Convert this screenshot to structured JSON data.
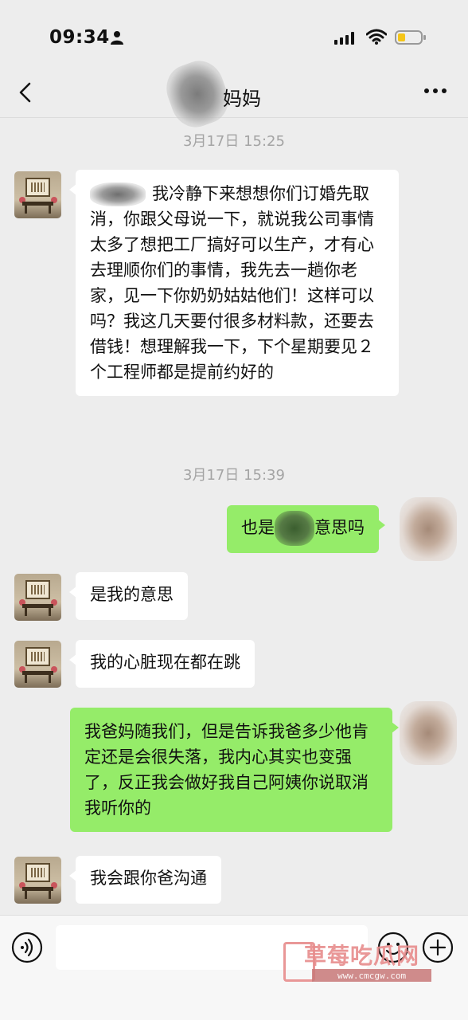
{
  "status_bar": {
    "time": "09:34",
    "icons": [
      "person-icon",
      "signal-icon",
      "wifi-icon",
      "battery-icon"
    ],
    "battery_color": "#f5c518"
  },
  "header": {
    "title": "妈妈",
    "back_icon": "chevron-left-icon",
    "more_icon": "more-dots-icon"
  },
  "messages": [
    {
      "type": "timestamp",
      "text": "3月17日 15:25"
    },
    {
      "type": "in",
      "text": "我冷静下来想想你们订婚先取消，你跟父母说一下，就说我公司事情太多了想把工厂搞好可以生产，才有心去理顺你们的事情，我先去一趟你老家，见一下你奶奶姑姑他们！这样可以吗？我这几天要付很多材料款，还要去借钱！想理解我一下，下个星期要见２个工程师都是提前约好的"
    },
    {
      "type": "timestamp",
      "text": "3月17日 15:39"
    },
    {
      "type": "out",
      "text_before": "也是",
      "text_after": "意思吗"
    },
    {
      "type": "in",
      "text": "是我的意思"
    },
    {
      "type": "in",
      "text": "我的心脏现在都在跳"
    },
    {
      "type": "out",
      "text": "我爸妈随我们，但是告诉我爸多少他肯定还是会很失落，我内心其实也变强了，反正我会做好我自己阿姨你说取消我听你的"
    },
    {
      "type": "in",
      "text": "我会跟你爸沟通"
    }
  ],
  "input_bar": {
    "placeholder": "",
    "icons": [
      "voice-icon",
      "emoji-icon",
      "plus-icon"
    ]
  },
  "watermark": {
    "text": "草莓吃瓜网",
    "url": "www.cmcgw.com"
  },
  "colors": {
    "background": "#ededed",
    "bubble_in": "#ffffff",
    "bubble_out": "#95ec69",
    "timestamp": "#a4a4a4"
  }
}
